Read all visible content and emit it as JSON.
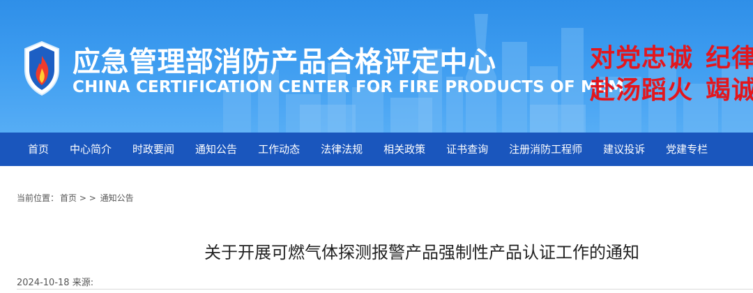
{
  "header": {
    "title_cn": "应急管理部消防产品合格评定中心",
    "title_en": "CHINA CERTIFICATION CENTER FOR FIRE PRODUCTS OF MEM",
    "slogan_line1": [
      "对党忠诚",
      "纪律严明"
    ],
    "slogan_line2": [
      "赴汤蹈火",
      "竭诚为民"
    ],
    "logo_icon": "fire-shield-logo-icon",
    "colors": {
      "banner": "#3d9cf0",
      "slogan": "#e3161d",
      "nav": "#1a56bd"
    }
  },
  "nav": {
    "items": [
      "首页",
      "中心简介",
      "时政要闻",
      "通知公告",
      "工作动态",
      "法律法规",
      "相关政策",
      "证书查询",
      "注册消防工程师",
      "建议投诉",
      "党建专栏"
    ]
  },
  "breadcrumb": {
    "prefix": "当前位置：",
    "home": "首页",
    "sep": "> >",
    "current": "通知公告"
  },
  "article": {
    "title": "关于开展可燃气体探测报警产品强制性产品认证工作的通知",
    "date": "2024-10-18",
    "source_label": "来源:"
  }
}
